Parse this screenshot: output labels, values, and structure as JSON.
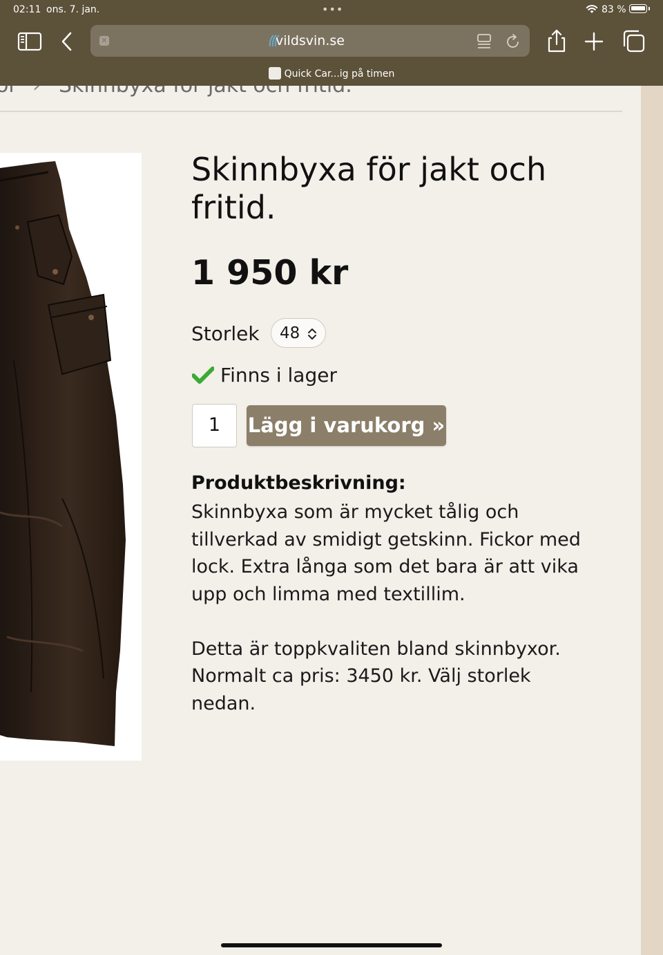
{
  "status_bar": {
    "time": "02:11",
    "date": "ons. 7. jan.",
    "battery_percent": "83 %",
    "battery_level": 0.83
  },
  "browser": {
    "url": "vildsvin.se",
    "tab_title": "Quick Car...ig på timen",
    "icons": [
      "sidebar-icon",
      "back-icon",
      "clear-icon",
      "reader-icon",
      "reload-icon",
      "share-icon",
      "new-tab-icon",
      "tabs-icon",
      "wifi-icon",
      "battery-icon"
    ]
  },
  "breadcrumb": {
    "previous": "or",
    "separator": "›",
    "current": "Skinnbyxa för jakt och fritid."
  },
  "product": {
    "title": "Skinnbyxa för jakt och fritid.",
    "price": "1 950 kr",
    "size_label": "Storlek",
    "size_value": "48",
    "stock_text": "Finns i lager",
    "quantity": "1",
    "cart_button": "Lägg i varukorg »",
    "description_heading": "Produktbeskrivning:",
    "description_1": "Skinnbyxa som är mycket tålig och tillverkad av smidigt getskinn. Fickor med lock. Extra långa som det bara är att vika upp och limma med textillim.",
    "description_2": "Detta är toppkvaliten bland skinnbyxor. Normalt ca pris: 3450 kr. Välj storlek nedan."
  },
  "colors": {
    "chrome": "#5c5139",
    "page_bg": "#f3efe9",
    "button": "#8b7f6a",
    "check": "#3aaa35"
  }
}
